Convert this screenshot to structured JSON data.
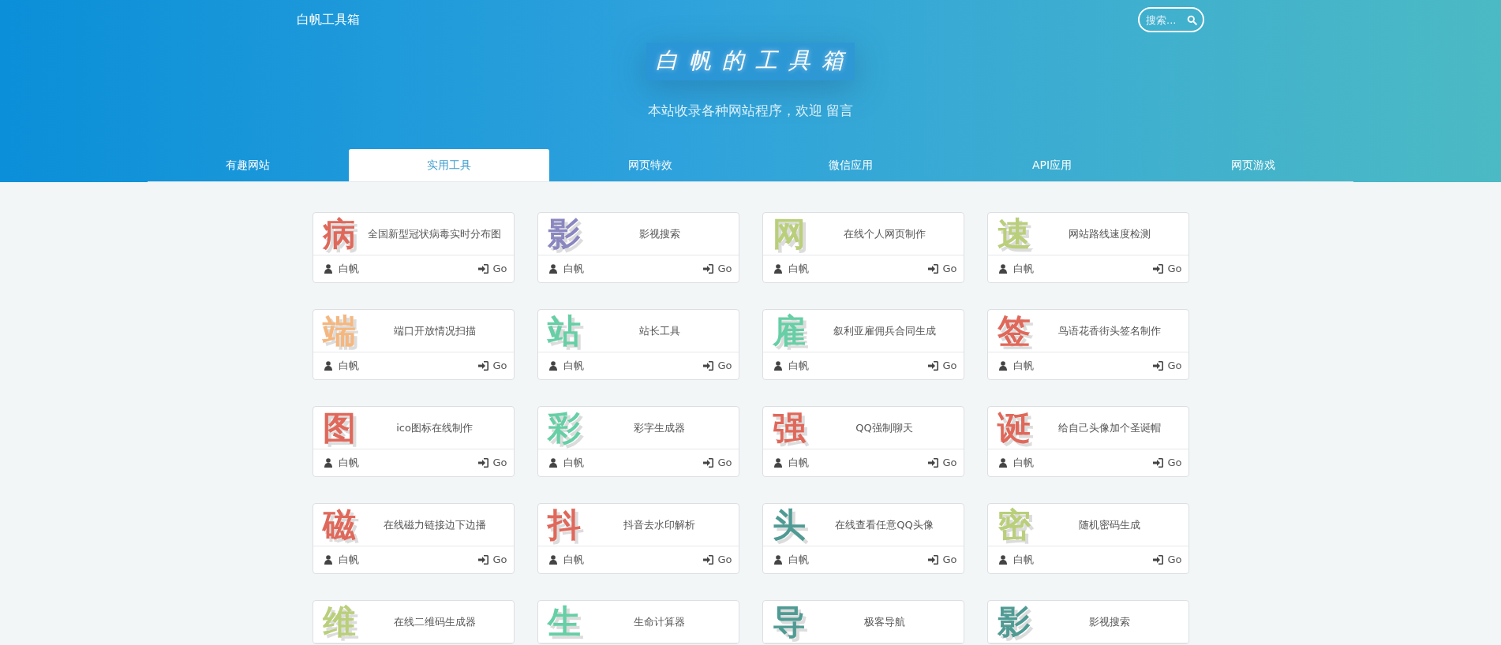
{
  "site_title": "白帆工具箱",
  "search": {
    "placeholder": "搜索..."
  },
  "hero": {
    "title": "白帆的工具箱",
    "subtitle": "本站收录各种网站程序，欢迎 留言"
  },
  "tabs": [
    {
      "label": "有趣网站",
      "selected": false
    },
    {
      "label": "实用工具",
      "selected": true
    },
    {
      "label": "网页特效",
      "selected": false
    },
    {
      "label": "微信应用",
      "selected": false
    },
    {
      "label": "API应用",
      "selected": false
    },
    {
      "label": "网页游戏",
      "selected": false
    }
  ],
  "cards": [
    {
      "glyph": "病",
      "color": "#e0685a",
      "title": "全国新型冠状病毒实时分布图",
      "author": "白帆",
      "link": "Go"
    },
    {
      "glyph": "影",
      "color": "#8a86c0",
      "title": "影视搜索",
      "author": "白帆",
      "link": "Go"
    },
    {
      "glyph": "网",
      "color": "#b9cf7a",
      "title": "在线个人网页制作",
      "author": "白帆",
      "link": "Go"
    },
    {
      "glyph": "速",
      "color": "#b9cf7a",
      "title": "网站路线速度检测",
      "author": "白帆",
      "link": "Go"
    },
    {
      "glyph": "端",
      "color": "#f5b77e",
      "title": "端口开放情况扫描",
      "author": "白帆",
      "link": "Go"
    },
    {
      "glyph": "站",
      "color": "#66cfa5",
      "title": "站长工具",
      "author": "白帆",
      "link": "Go"
    },
    {
      "glyph": "雇",
      "color": "#66cfa5",
      "title": "叙利亚雇佣兵合同生成",
      "author": "白帆",
      "link": "Go"
    },
    {
      "glyph": "签",
      "color": "#e0685a",
      "title": "鸟语花香街头签名制作",
      "author": "白帆",
      "link": "Go"
    },
    {
      "glyph": "图",
      "color": "#e0685a",
      "title": "ico图标在线制作",
      "author": "白帆",
      "link": "Go"
    },
    {
      "glyph": "彩",
      "color": "#66cfa5",
      "title": "彩字生成器",
      "author": "白帆",
      "link": "Go"
    },
    {
      "glyph": "强",
      "color": "#e0685a",
      "title": "QQ强制聊天",
      "author": "白帆",
      "link": "Go"
    },
    {
      "glyph": "诞",
      "color": "#e0685a",
      "title": "给自己头像加个圣诞帽",
      "author": "白帆",
      "link": "Go"
    },
    {
      "glyph": "磁",
      "color": "#e0685a",
      "title": "在线磁力链接边下边播",
      "author": "白帆",
      "link": "Go"
    },
    {
      "glyph": "抖",
      "color": "#e0685a",
      "title": "抖音去水印解析",
      "author": "白帆",
      "link": "Go"
    },
    {
      "glyph": "头",
      "color": "#4f9b94",
      "title": "在线查看任意QQ头像",
      "author": "白帆",
      "link": "Go"
    },
    {
      "glyph": "密",
      "color": "#b9cf7a",
      "title": "随机密码生成",
      "author": "白帆",
      "link": "Go"
    },
    {
      "glyph": "维",
      "color": "#b9cf7a",
      "title": "在线二维码生成器"
    },
    {
      "glyph": "生",
      "color": "#66cfa5",
      "title": "生命计算器"
    },
    {
      "glyph": "导",
      "color": "#4f9b94",
      "title": "极客导航"
    },
    {
      "glyph": "影",
      "color": "#4f9b94",
      "title": "影视搜索"
    }
  ]
}
